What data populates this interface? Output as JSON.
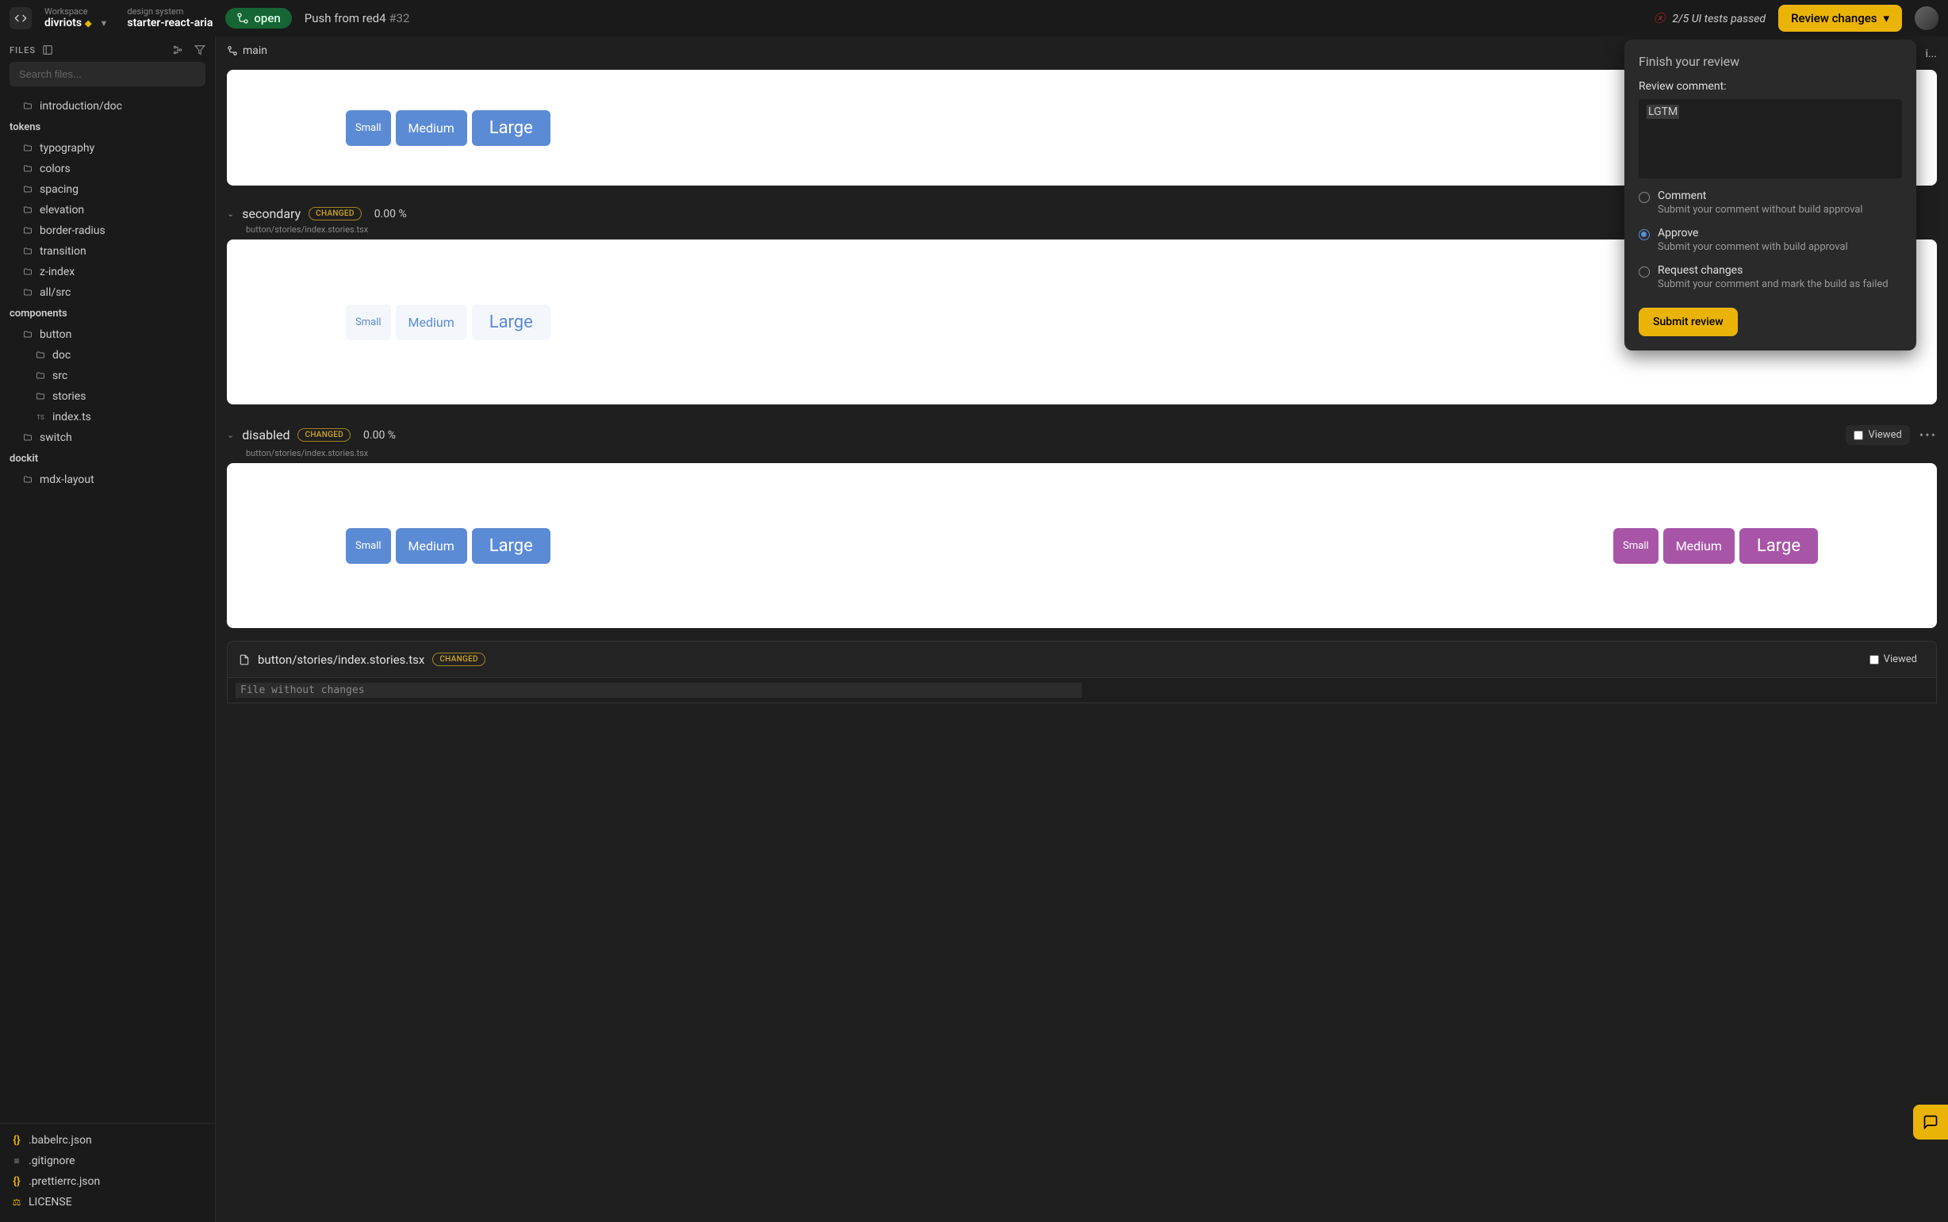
{
  "topbar": {
    "workspace_label": "Workspace",
    "workspace_name": "divriots",
    "ds_label": "design system",
    "ds_name": "starter-react-aria",
    "status_open": "open",
    "push_text": "Push from red4",
    "pr_number": "#32",
    "tests_status": "2/5 UI tests passed",
    "review_button": "Review changes"
  },
  "sidebar": {
    "files_label": "FILES",
    "search_placeholder": "Search files...",
    "items": {
      "introduction": "introduction/doc",
      "section_tokens": "tokens",
      "typography": "typography",
      "colors": "colors",
      "spacing": "spacing",
      "elevation": "elevation",
      "border_radius": "border-radius",
      "transition": "transition",
      "z_index": "z-index",
      "all_src": "all/src",
      "section_components": "components",
      "button": "button",
      "doc": "doc",
      "src": "src",
      "stories": "stories",
      "index_ts": "index.ts",
      "switch": "switch",
      "section_dockit": "dockit",
      "mdx_layout": "mdx-layout"
    },
    "bottom": {
      "babelrc": ".babelrc.json",
      "gitignore": ".gitignore",
      "prettierrc": ".prettierrc.json",
      "license": "LICENSE"
    }
  },
  "content": {
    "branch": "main",
    "truncated_top": "i...",
    "buttons": {
      "small": "Small",
      "medium": "Medium",
      "large": "Large"
    },
    "stories": {
      "secondary": {
        "title": "secondary",
        "badge": "CHANGED",
        "percent": "0.00 %",
        "path": "button/stories/index.stories.tsx"
      },
      "disabled": {
        "title": "disabled",
        "badge": "CHANGED",
        "percent": "0.00 %",
        "path": "button/stories/index.stories.tsx",
        "viewed": "Viewed"
      }
    },
    "code_file": {
      "path": "button/stories/index.stories.tsx",
      "badge": "CHANGED",
      "viewed": "Viewed",
      "no_changes": "File without changes"
    }
  },
  "popup": {
    "title": "Finish your review",
    "comment_label": "Review comment:",
    "comment_value": "LGTM",
    "options": {
      "comment": {
        "label": "Comment",
        "desc": "Submit your comment without build approval"
      },
      "approve": {
        "label": "Approve",
        "desc": "Submit your comment with build approval"
      },
      "request": {
        "label": "Request changes",
        "desc": "Submit your comment and mark the build as failed"
      }
    },
    "submit": "Submit review"
  }
}
